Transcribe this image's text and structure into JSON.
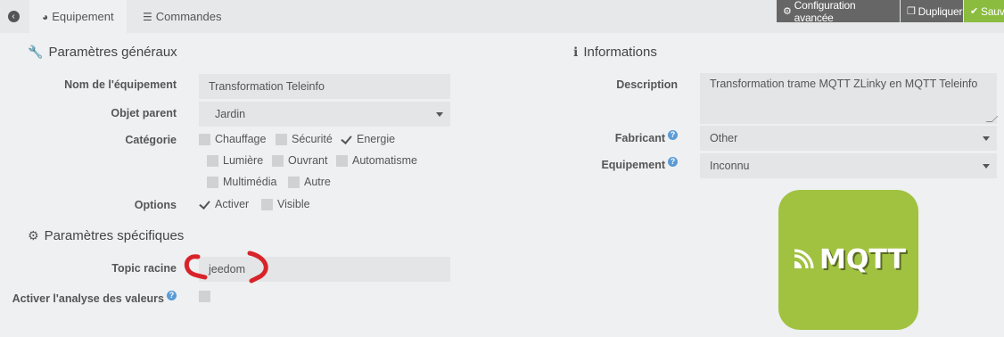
{
  "tabs": [
    {
      "label": "Equipement",
      "icon": "dashboard-icon"
    },
    {
      "label": "Commandes",
      "icon": "list-icon"
    }
  ],
  "actions": {
    "config_label": "Configuration avancée",
    "duplicate_label": "Dupliquer",
    "save_label": "Sauve"
  },
  "general": {
    "title": "Paramètres généraux",
    "name_label": "Nom de l'équipement",
    "name_value": "Transformation Teleinfo",
    "parent_label": "Objet parent",
    "parent_value": "Jardin",
    "category_label": "Catégorie",
    "categories": [
      {
        "label": "Chauffage",
        "checked": false
      },
      {
        "label": "Sécurité",
        "checked": false
      },
      {
        "label": "Energie",
        "checked": true
      },
      {
        "label": "Lumière",
        "checked": false
      },
      {
        "label": "Ouvrant",
        "checked": false
      },
      {
        "label": "Automatisme",
        "checked": false
      },
      {
        "label": "Multimédia",
        "checked": false
      },
      {
        "label": "Autre",
        "checked": false
      }
    ],
    "options_label": "Options",
    "options": [
      {
        "label": "Activer",
        "checked": true
      },
      {
        "label": "Visible",
        "checked": false
      }
    ]
  },
  "specific": {
    "title": "Paramètres spécifiques",
    "topic_label": "Topic racine",
    "topic_value": "jeedom",
    "analysis_label": "Activer l'analyse des valeurs",
    "analysis_checked": false
  },
  "info": {
    "title": "Informations",
    "description_label": "Description",
    "description_value": "Transformation trame MQTT ZLinky en MQTT Teleinfo",
    "maker_label": "Fabricant",
    "maker_value": "Other",
    "equipment_label": "Equipement",
    "equipment_value": "Inconnu",
    "logo_text": "MQTT"
  },
  "colors": {
    "accent_green": "#8bbc3f",
    "logo_green": "#a1c240",
    "annotation_red": "#d8232a"
  }
}
